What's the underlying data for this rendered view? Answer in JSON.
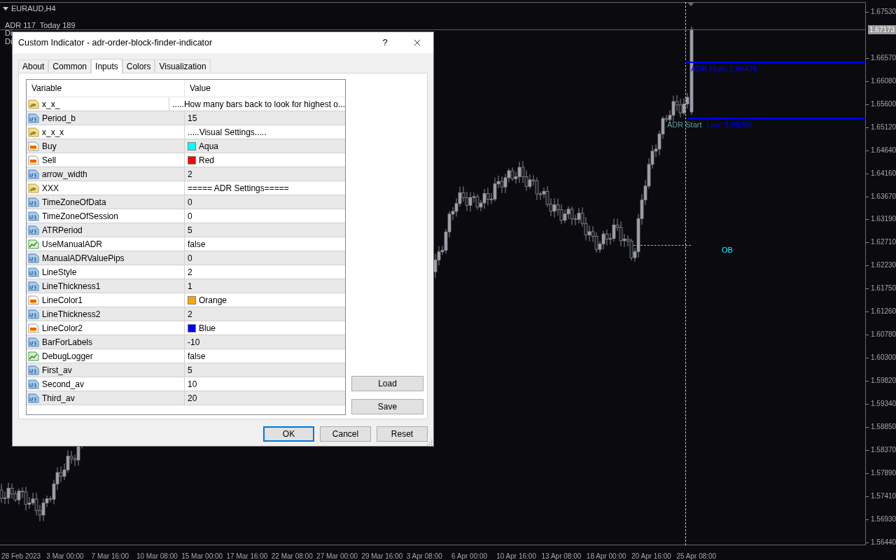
{
  "chart": {
    "symbol": "EURAUD,H4",
    "info": "ADR 117  Today 189",
    "hidden_lines": [
      "Di",
      "Di"
    ],
    "current_price": "1.67173",
    "price_labels": [
      "1.67530",
      "1.66570",
      "1.66080",
      "1.65600",
      "1.65120",
      "1.64640",
      "1.64160",
      "1.63670",
      "1.63190",
      "1.62710",
      "1.62230",
      "1.61750",
      "1.61260",
      "1.60780",
      "1.60300",
      "1.59820",
      "1.59340",
      "1.58850",
      "1.58370",
      "1.57890",
      "1.57410",
      "1.56930",
      "1.56440"
    ],
    "time_labels": [
      "28 Feb 2023",
      "3 Mar 00:00",
      "7 Mar 16:00",
      "10 Mar 08:00",
      "15 Mar 00:00",
      "17 Mar 16:00",
      "22 Mar 08:00",
      "27 Mar 00:00",
      "29 Mar 16:00",
      "3 Apr 08:00",
      "6 Apr 00:00",
      "10 Apr 16:00",
      "13 Apr 08:00",
      "18 Apr 00:00",
      "20 Apr 16:00",
      "25 Apr 08:00"
    ],
    "objects": [
      {
        "kind": "adr_high",
        "label": "ADR High: 1.66476"
      },
      {
        "kind": "adr_start",
        "label": "ADR Start"
      },
      {
        "kind": "adr_low",
        "label": "Low: 1.65306"
      },
      {
        "kind": "ob",
        "label": "OB"
      }
    ]
  },
  "dialog": {
    "title": "Custom Indicator - adr-order-block-finder-indicator",
    "help": "?",
    "tabs": [
      {
        "label": "About",
        "selected": false
      },
      {
        "label": "Common",
        "selected": false
      },
      {
        "label": "Inputs",
        "selected": true
      },
      {
        "label": "Colors",
        "selected": false
      },
      {
        "label": "Visualization",
        "selected": false
      }
    ],
    "table": {
      "columns": [
        "Variable",
        "Value"
      ],
      "rows": [
        {
          "kind": "string",
          "variable": "x_x_",
          "value": ".....How many bars back to look for highest o..."
        },
        {
          "kind": "int",
          "variable": "Period_b",
          "value": "15"
        },
        {
          "kind": "string",
          "variable": "x_x_x",
          "value": ".....Visual Settings....."
        },
        {
          "kind": "color",
          "variable": "Buy",
          "value": "Aqua",
          "color": "#00ffff"
        },
        {
          "kind": "color",
          "variable": "Sell",
          "value": "Red",
          "color": "#ff0000"
        },
        {
          "kind": "int",
          "variable": "arrow_width",
          "value": "2"
        },
        {
          "kind": "string",
          "variable": "XXX",
          "value": "===== ADR Settings====="
        },
        {
          "kind": "int",
          "variable": "TimeZoneOfData",
          "value": "0"
        },
        {
          "kind": "int",
          "variable": "TimeZoneOfSession",
          "value": "0"
        },
        {
          "kind": "int",
          "variable": "ATRPeriod",
          "value": "5"
        },
        {
          "kind": "bool",
          "variable": "UseManualADR",
          "value": "false"
        },
        {
          "kind": "int",
          "variable": "ManualADRValuePips",
          "value": "0"
        },
        {
          "kind": "int",
          "variable": "LineStyle",
          "value": "2"
        },
        {
          "kind": "int",
          "variable": "LineThickness1",
          "value": "1"
        },
        {
          "kind": "color",
          "variable": "LineColor1",
          "value": "Orange",
          "color": "#ffa500"
        },
        {
          "kind": "int",
          "variable": "LineThickness2",
          "value": "2"
        },
        {
          "kind": "color",
          "variable": "LineColor2",
          "value": "Blue",
          "color": "#0000ff"
        },
        {
          "kind": "int",
          "variable": "BarForLabels",
          "value": "-10"
        },
        {
          "kind": "bool",
          "variable": "DebugLogger",
          "value": "false"
        },
        {
          "kind": "int",
          "variable": "First_av",
          "value": "5"
        },
        {
          "kind": "int",
          "variable": "Second_av",
          "value": "10"
        },
        {
          "kind": "int",
          "variable": "Third_av",
          "value": "20"
        }
      ]
    },
    "side_buttons": [
      "Load",
      "Save"
    ],
    "buttons": [
      {
        "label": "OK",
        "default": true
      },
      {
        "label": "Cancel",
        "default": false
      },
      {
        "label": "Reset",
        "default": false
      }
    ]
  }
}
